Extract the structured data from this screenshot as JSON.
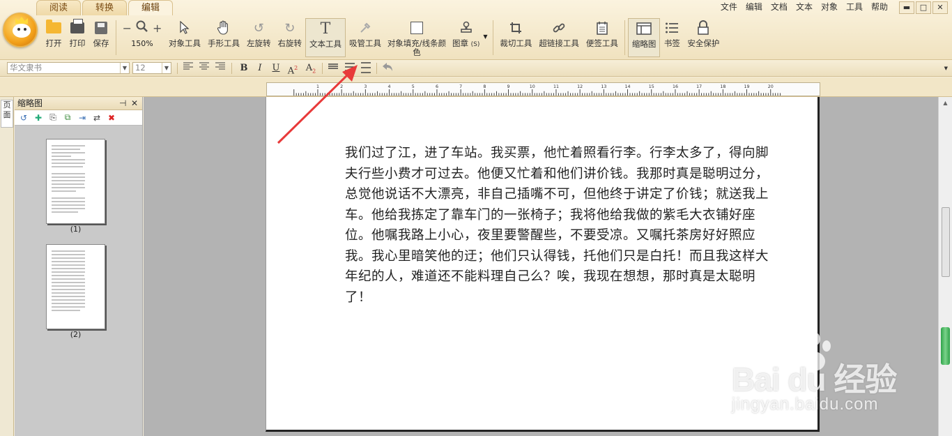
{
  "tabs": [
    {
      "label": "阅读"
    },
    {
      "label": "转换"
    },
    {
      "label": "编辑"
    }
  ],
  "menu": [
    "文件",
    "编辑",
    "文档",
    "文本",
    "对象",
    "工具",
    "帮助"
  ],
  "window_controls": {
    "minimize": "▬",
    "maximize": "□",
    "close": "✕"
  },
  "toolbar": {
    "open": "打开",
    "print": "打印",
    "save": "保存",
    "zoom_minus": "−",
    "zoom_plus": "+",
    "zoom_level": "150%",
    "object_tool": "对象工具",
    "hand_tool": "手形工具",
    "rotate_left": "左旋转",
    "rotate_right": "右旋转",
    "text_tool": "文本工具",
    "eyedropper": "吸管工具",
    "fill_color": "对象填充/线条颜色",
    "stamp": "图章",
    "stamp_hint": "(S)",
    "crop_tool": "裁切工具",
    "hyperlink_tool": "超链接工具",
    "note_tool": "便签工具",
    "thumbnail": "缩略图",
    "bookmark": "书签",
    "security": "安全保护"
  },
  "format": {
    "font_name": "华文隶书",
    "font_size": "12",
    "bold": "B",
    "italic": "I",
    "underline": "U",
    "superscript": "A",
    "subscript": "A"
  },
  "ruler": {
    "labels": [
      "1",
      "2",
      "3",
      "4",
      "5",
      "6",
      "7",
      "8",
      "9",
      "10",
      "11",
      "12",
      "13",
      "14",
      "15",
      "16",
      "17",
      "18",
      "19",
      "20"
    ]
  },
  "left_strip": {
    "label": "页面"
  },
  "thumb_panel": {
    "title": "缩略图",
    "pin": "⊣",
    "close": "✕",
    "pages": [
      {
        "label": "(1)"
      },
      {
        "label": "(2)"
      }
    ]
  },
  "document": {
    "text": "我们过了江，进了车站。我买票，他忙着照看行李。行李太多了，得向脚夫行些小费才可过去。他便又忙着和他们讲价钱。我那时真是聪明过分，总觉他说话不大漂亮，非自己插嘴不可，但他终于讲定了价钱；就送我上车。他给我拣定了靠车门的一张椅子；我将他给我做的紫毛大衣铺好座位。他嘱我路上小心，夜里要警醒些，不要受凉。又嘱托茶房好好照应我。我心里暗笑他的迂；他们只认得钱，托他们只是白托！而且我这样大年纪的人，难道还不能料理自己么？唉，我现在想想，那时真是太聪明了！"
  },
  "watermark": {
    "logo": "Bai du 经验",
    "url": "jingyan.baidu.com"
  },
  "colors": {
    "accent_arrow": "#e83a3a",
    "ribbon": "#f0e2bf",
    "scroll_grip": "#2fa34a"
  }
}
